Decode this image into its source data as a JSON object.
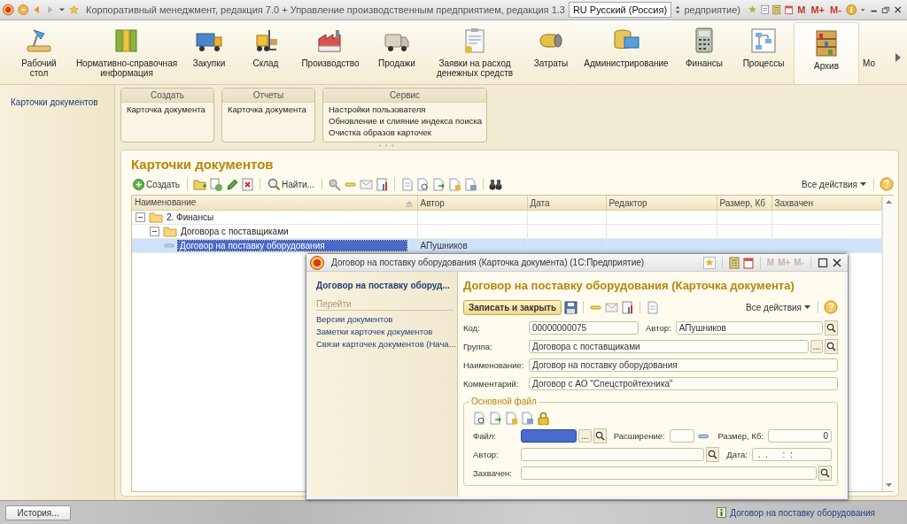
{
  "title_bar": {
    "title": "Корпоративный менеджмент, редакция 7.0 + Управление производственным предприятием, редакция 1.3",
    "language": "RU Русский (Россия)",
    "title_tail": "редприятие)",
    "memory_buttons": [
      "M",
      "M+",
      "M-"
    ]
  },
  "sections": [
    {
      "label": "Рабочий\nстол",
      "selected": false
    },
    {
      "label": "Нормативно-справочная\nинформация",
      "selected": false
    },
    {
      "label": "Закупки",
      "selected": false
    },
    {
      "label": "Склад",
      "selected": false
    },
    {
      "label": "Производство",
      "selected": false
    },
    {
      "label": "Продажи",
      "selected": false
    },
    {
      "label": "Заявки на расход\nденежных средств",
      "selected": false
    },
    {
      "label": "Затраты",
      "selected": false
    },
    {
      "label": "Администрирование",
      "selected": false
    },
    {
      "label": "Финансы",
      "selected": false
    },
    {
      "label": "Процессы",
      "selected": false
    },
    {
      "label": "Архив",
      "selected": true
    },
    {
      "label": "Мо",
      "selected": false
    }
  ],
  "nav_panel": {
    "items": [
      {
        "label": "Карточки документов"
      }
    ]
  },
  "command_groups": [
    {
      "title": "Создать",
      "items": [
        "Карточка документа"
      ]
    },
    {
      "title": "Отчеты",
      "items": [
        "Карточка документа"
      ]
    },
    {
      "title": "Сервис",
      "items": [
        "Настройки пользователя",
        "Обновление и слияние индекса поиска",
        "Очистка образов карточек"
      ]
    }
  ],
  "list": {
    "title": "Карточки документов",
    "create_button": "Создать",
    "find_button": "Найти...",
    "all_actions": "Все действия",
    "columns": [
      "Наименование",
      "Автор",
      "Дата",
      "Редактор",
      "Размер, Кб",
      "Захвачен"
    ],
    "rows": [
      {
        "kind": "folder",
        "name": "2. Финансы",
        "expanded": true,
        "selected": false,
        "children": [
          {
            "kind": "folder",
            "name": "Договора с поставщиками",
            "expanded": true,
            "selected": false,
            "children": [
              {
                "kind": "item",
                "name": "Договор на поставку оборудования",
                "author": "АПушников",
                "selected": true
              }
            ]
          }
        ]
      }
    ]
  },
  "form": {
    "window_title": "Договор на поставку оборудования  (Карточка документа)  (1С:Предприятие)",
    "memory_buttons": [
      "M",
      "M+",
      "M-"
    ],
    "nav_title": "Договор на поставку оборуд...",
    "nav_section": "Перейти",
    "nav_links": [
      "Версии документов",
      "Заметки карточек документов",
      "Связи карточек документов (Нача..."
    ],
    "heading": "Договор на поставку оборудования  (Карточка документа)",
    "save_button": "Записать и закрыть",
    "all_actions": "Все действия",
    "code": {
      "label": "Код:",
      "value": "00000000075"
    },
    "author": {
      "label": "Автор:",
      "value": "АПушников"
    },
    "group": {
      "label": "Группа:",
      "value": "Договора с поставщиками",
      "choose_button": "..."
    },
    "name": {
      "label": "Наименование:",
      "value": "Договор на поставку оборудования"
    },
    "comment": {
      "label": "Комментарий:",
      "value": "Договор с АО \"Спецстройтехника\""
    },
    "file_group": {
      "title": "Основной файл",
      "file": {
        "label": "Файл:",
        "choose_button": "..."
      },
      "extension": {
        "label": "Расширение:"
      },
      "size": {
        "label": "Размер, Кб:",
        "value": "0"
      },
      "file_author": {
        "label": "Автор:"
      },
      "date": {
        "label": "Дата:",
        "value": " .  .      :  :"
      },
      "captured": {
        "label": "Захвачен:"
      }
    }
  },
  "status_bar": {
    "history_button": "История...",
    "message": "Договор на поставку оборудования"
  }
}
